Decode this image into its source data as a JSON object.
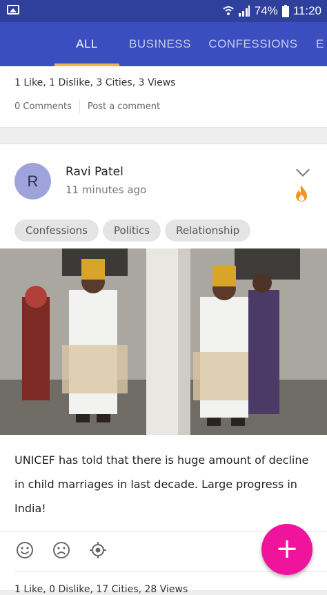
{
  "status_bar": {
    "battery": "74%",
    "time": "11:20"
  },
  "tabs": [
    {
      "label": "ALL",
      "active": true
    },
    {
      "label": "BUSINESS",
      "active": false
    },
    {
      "label": "CONFESSIONS",
      "active": false
    },
    {
      "label": "E",
      "active": false
    }
  ],
  "prev_post": {
    "stats": "1 Like, 1 Dislike, 3 Cities, 3 Views",
    "comments": "0 Comments",
    "post_comment": "Post a comment"
  },
  "post": {
    "avatar_letter": "R",
    "author": "Ravi Patel",
    "time": "11 minutes ago",
    "tags": [
      "Confessions",
      "Politics",
      "Relationship"
    ],
    "text": "UNICEF has told that there is huge amount of decline in child marriages in last decade. Large progress in India!",
    "icons": [
      "chevron-down-icon",
      "fire-icon",
      "smile-icon",
      "sad-icon",
      "location-target-icon"
    ]
  },
  "next_post": {
    "stats": "1 Like, 0 Dislike, 17 Cities, 28 Views"
  },
  "fab": {
    "label": "+"
  },
  "colors": {
    "status_bar": "#2f3f9c",
    "tab_bar": "#3a4ebf",
    "tab_indicator": "#f7b24f",
    "fab": "#f0139b",
    "avatar": "#9fa3dc"
  }
}
